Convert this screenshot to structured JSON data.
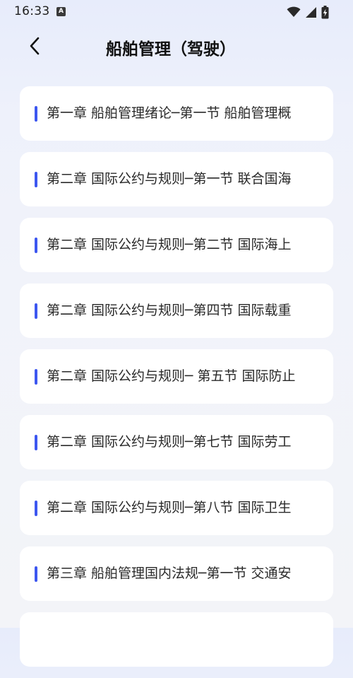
{
  "status_bar": {
    "time": "16:33",
    "app_icon_letter": "A",
    "icons": [
      "wifi-icon",
      "cellular-signal-icon",
      "battery-charging-icon"
    ]
  },
  "header": {
    "title": "船舶管理（驾驶）",
    "back_icon": "chevron-left-icon"
  },
  "colors": {
    "accent": "#3d57f0",
    "card_background": "#ffffff"
  },
  "list": {
    "items": [
      {
        "label": "第一章 船舶管理绪论─第一节 船舶管理概"
      },
      {
        "label": "第二章 国际公约与规则─第一节 联合国海"
      },
      {
        "label": "第二章 国际公约与规则─第二节 国际海上"
      },
      {
        "label": "第二章 国际公约与规则─第四节 国际载重"
      },
      {
        "label": "第二章 国际公约与规则─ 第五节 国际防止"
      },
      {
        "label": "第二章 国际公约与规则─第七节 国际劳工"
      },
      {
        "label": "第二章 国际公约与规则─第八节 国际卫生"
      },
      {
        "label": "第三章 船舶管理国内法规─第一节 交通安"
      },
      {
        "label": ""
      }
    ]
  }
}
